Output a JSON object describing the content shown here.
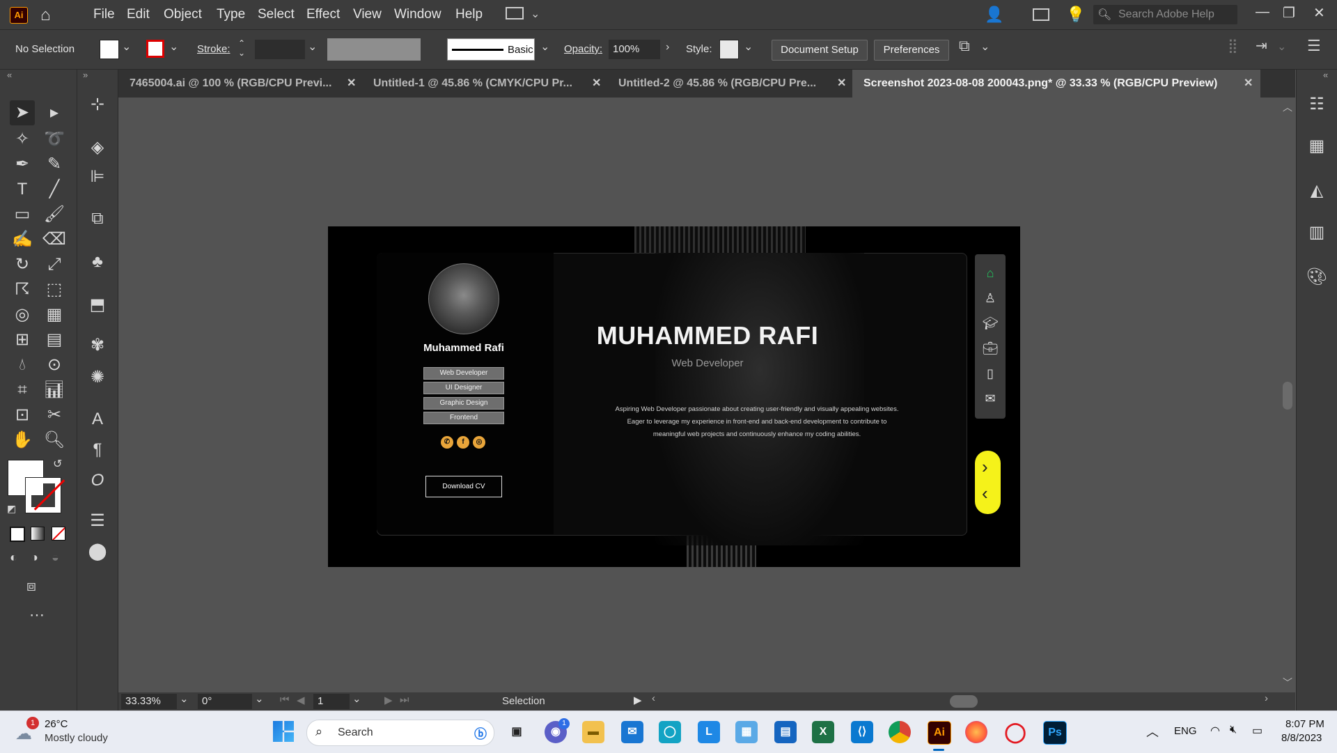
{
  "menubar": {
    "app_icon": "Ai",
    "items": [
      "File",
      "Edit",
      "Object",
      "Type",
      "Select",
      "Effect",
      "View",
      "Window",
      "Help"
    ],
    "search_placeholder": "Search Adobe Help"
  },
  "controlbar": {
    "selection": "No Selection",
    "stroke_label": "Stroke:",
    "brush_label": "Basic",
    "opacity_label": "Opacity:",
    "opacity_value": "100%",
    "style_label": "Style:",
    "document_setup": "Document Setup",
    "preferences": "Preferences"
  },
  "tabs": [
    {
      "label": "7465004.ai @ 100 % (RGB/CPU Previ...",
      "active": false
    },
    {
      "label": "Untitled-1 @ 45.86 % (CMYK/CPU Pr...",
      "active": false
    },
    {
      "label": "Untitled-2 @ 45.86 % (RGB/CPU Pre...",
      "active": false
    },
    {
      "label": "Screenshot 2023-08-08 200043.png* @ 33.33 % (RGB/CPU Preview)",
      "active": true
    }
  ],
  "artboard": {
    "profile_name": "Muhammed Rafi",
    "skills": [
      "Web Developer",
      "UI Designer",
      "Graphic Design",
      "Frontend"
    ],
    "download_cv": "Download CV",
    "hero_title": "MUHAMMED RAFI",
    "hero_subtitle": "Web Developer",
    "bio": "Aspiring Web Developer passionate about creating user-friendly and visually appealing websites. Eager to leverage my experience in front-end and back-end development to contribute to meaningful web projects and continuously enhance my coding abilities."
  },
  "statusbar": {
    "zoom": "33.33%",
    "rotation": "0°",
    "artboard_number": "1",
    "tool_status": "Selection"
  },
  "taskbar": {
    "weather_temp": "26°C",
    "weather_desc": "Mostly cloudy",
    "weather_badge": "1",
    "search_label": "Search",
    "language": "ENG",
    "time": "8:07 PM",
    "date": "8/8/2023",
    "teams_badge": "1"
  },
  "colors": {
    "accent_yellow": "#f5f21a",
    "home_icon_green": "#22c55e",
    "social_orange": "#e9a53a",
    "ai_orange": "#ff9a00"
  }
}
